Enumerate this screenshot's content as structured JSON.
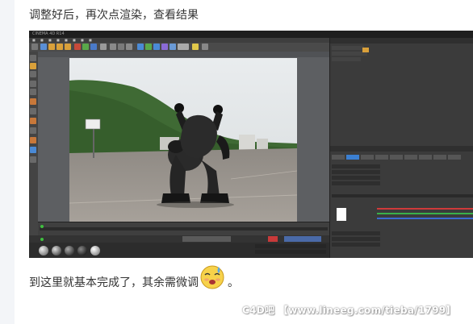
{
  "post": {
    "caption_top": "调整好后，再次点渲染，查看结果",
    "caption_bottom": "到这里就基本完成了，其余需微调",
    "caption_bottom_end": "。",
    "emoji": "sweat-emoji",
    "watermark": "C4D吧 【www.lineeg.com/tieba/1799】"
  },
  "app": {
    "name": "Cinema 4D",
    "title": "CINEMA 4D R14"
  },
  "colors": {
    "viewport_bg": "#5d5f62",
    "panel_bg": "#3b3b3b",
    "toolbar_bg": "#4a4a4a",
    "accent_blue": "#3b7fd1",
    "orange": "#e08a2a"
  }
}
